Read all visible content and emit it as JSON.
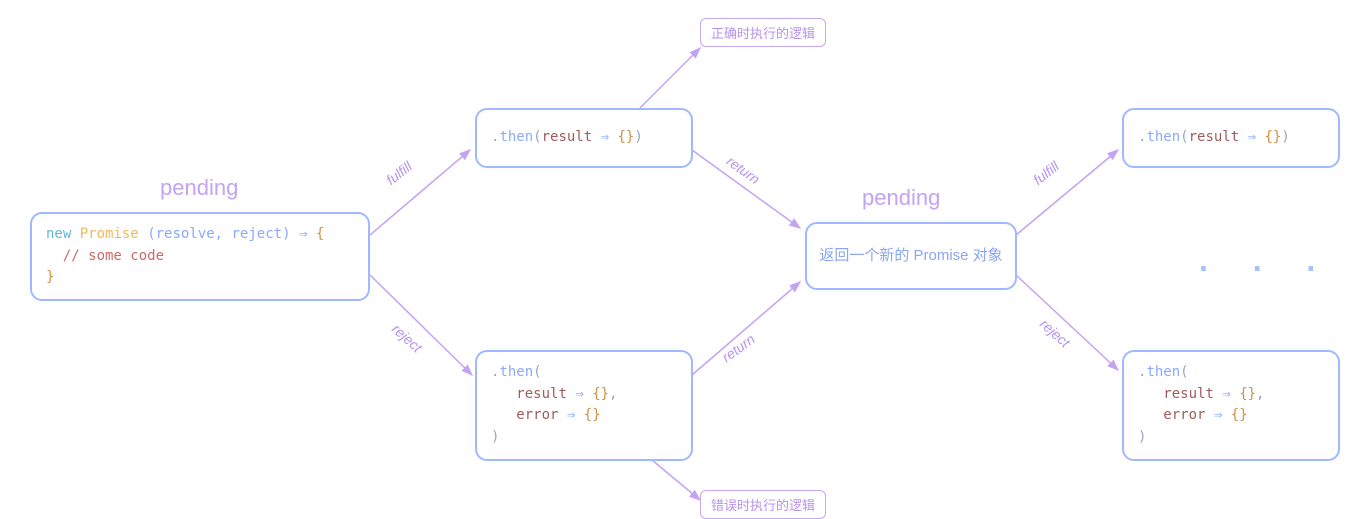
{
  "titles": {
    "pending1": "pending",
    "pending2": "pending"
  },
  "smallBoxes": {
    "correct": "正确时执行的逻辑",
    "error": "错误时执行的逻辑"
  },
  "arrowLabels": {
    "fulfill1": "fulfill",
    "reject1": "reject",
    "return1": "return",
    "return2": "return",
    "fulfill2": "fulfill",
    "reject2": "reject"
  },
  "newPromise": {
    "code_html": "<span class='tk-keyword'>new</span> <span class='tk-classname'>Promise</span> <span class='tk-punc'>(</span><span class='tk-params'>resolve, reject</span><span class='tk-punc'>)</span> <span class='tk-arrow'>⇒</span> <span class='tk-bracket'>{</span>\n  <span class='tk-comment'>// some code</span>\n<span class='tk-bracket'>}</span>"
  },
  "thenA": {
    "code_html": "<span class='tk-dim'>.</span><span class='tk-method'>then</span><span class='tk-dim'>(</span><span class='tk-arg'>result</span> <span class='tk-arrow'>⇒</span> <span class='tk-bracket'>{}</span><span class='tk-dim'>)</span>"
  },
  "thenB": {
    "code_html": "<span class='tk-dim'>.</span><span class='tk-method'>then</span><span class='tk-dim'>(</span>\n   <span class='tk-arg'>result</span> <span class='tk-arrow'>⇒</span> <span class='tk-bracket'>{}</span><span class='tk-dim'>,</span>\n   <span class='tk-arg'>error</span> <span class='tk-arrow'>⇒</span> <span class='tk-bracket'>{}</span>\n<span class='tk-dim'>)</span>"
  },
  "midBox": {
    "text": "返回一个新的 Promise 对象"
  },
  "thenC": {
    "code_html": "<span class='tk-dim'>.</span><span class='tk-method'>then</span><span class='tk-dim'>(</span><span class='tk-arg'>result</span> <span class='tk-arrow'>⇒</span> <span class='tk-bracket'>{}</span><span class='tk-dim'>)</span>"
  },
  "thenD": {
    "code_html": "<span class='tk-dim'>.</span><span class='tk-method'>then</span><span class='tk-dim'>(</span>\n   <span class='tk-arg'>result</span> <span class='tk-arrow'>⇒</span> <span class='tk-bracket'>{}</span><span class='tk-dim'>,</span>\n   <span class='tk-arg'>error</span> <span class='tk-arrow'>⇒</span> <span class='tk-bracket'>{}</span>\n<span class='tk-dim'>)</span>"
  },
  "ellipsis": ". . ."
}
